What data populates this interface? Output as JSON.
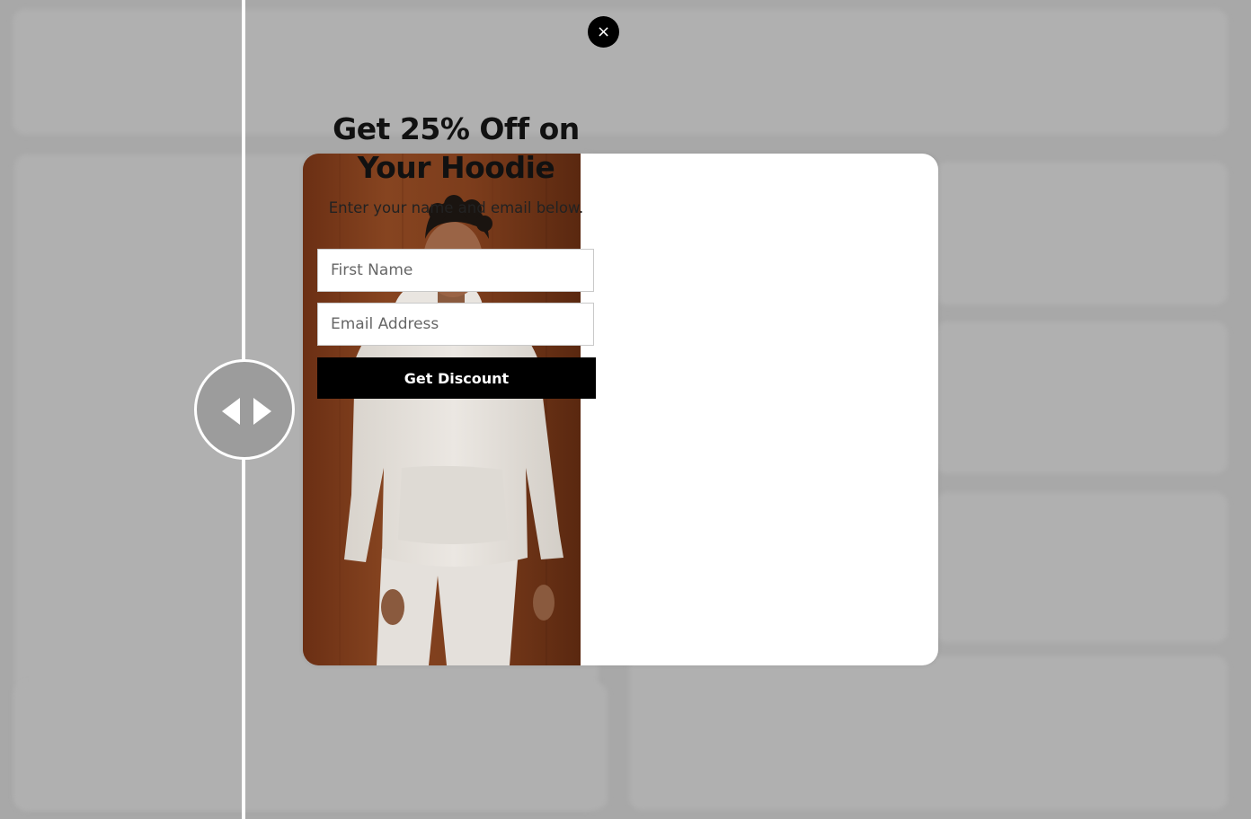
{
  "popup": {
    "headline": "Get 25% Off on Your Hoodie",
    "subtext": "Enter your name and email below.",
    "close_label": "×",
    "fields": {
      "first_name": {
        "placeholder": "First Name",
        "value": ""
      },
      "email": {
        "placeholder": "Email Address",
        "value": ""
      }
    },
    "submit_label": "Get Discount"
  },
  "colors": {
    "backdrop": "#a8a8a8",
    "button": "#000000",
    "button_text": "#ffffff",
    "photo_background": "#7b3a1a"
  },
  "icons": {
    "close": "close-icon",
    "compare_handle": "left-right-arrows-icon"
  }
}
